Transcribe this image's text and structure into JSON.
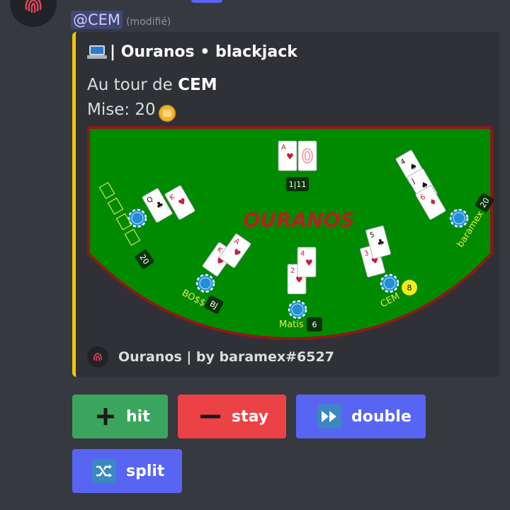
{
  "message": {
    "mention": "@CEM",
    "edited": "(modifié)"
  },
  "embed": {
    "author": "| Ouranos • blackjack",
    "description": {
      "turn_prefix": "Au tour de ",
      "turn_player": "CEM",
      "bet_label": "Mise: 20"
    },
    "accent_color": "#f1c40f",
    "footer": "Ouranos | by baramex#6527"
  },
  "table": {
    "brand": "OURANOS",
    "dealer_score": "1|11",
    "players": [
      {
        "name": "",
        "score": "20",
        "chip": "20"
      },
      {
        "name": "BO$$",
        "score": "BJ",
        "chip": "20"
      },
      {
        "name": "Matis",
        "score": "6",
        "chip": "20"
      },
      {
        "name": "CEM",
        "score": "8",
        "chip": "20"
      },
      {
        "name": "baramex",
        "score": "20",
        "chip": "20"
      }
    ]
  },
  "buttons": {
    "hit": {
      "label": "hit",
      "icon": "plus-icon"
    },
    "stay": {
      "label": "stay",
      "icon": "minus-icon"
    },
    "double": {
      "label": "double",
      "icon": "fast-forward-icon"
    },
    "split": {
      "label": "split",
      "icon": "shuffle-icon"
    }
  }
}
